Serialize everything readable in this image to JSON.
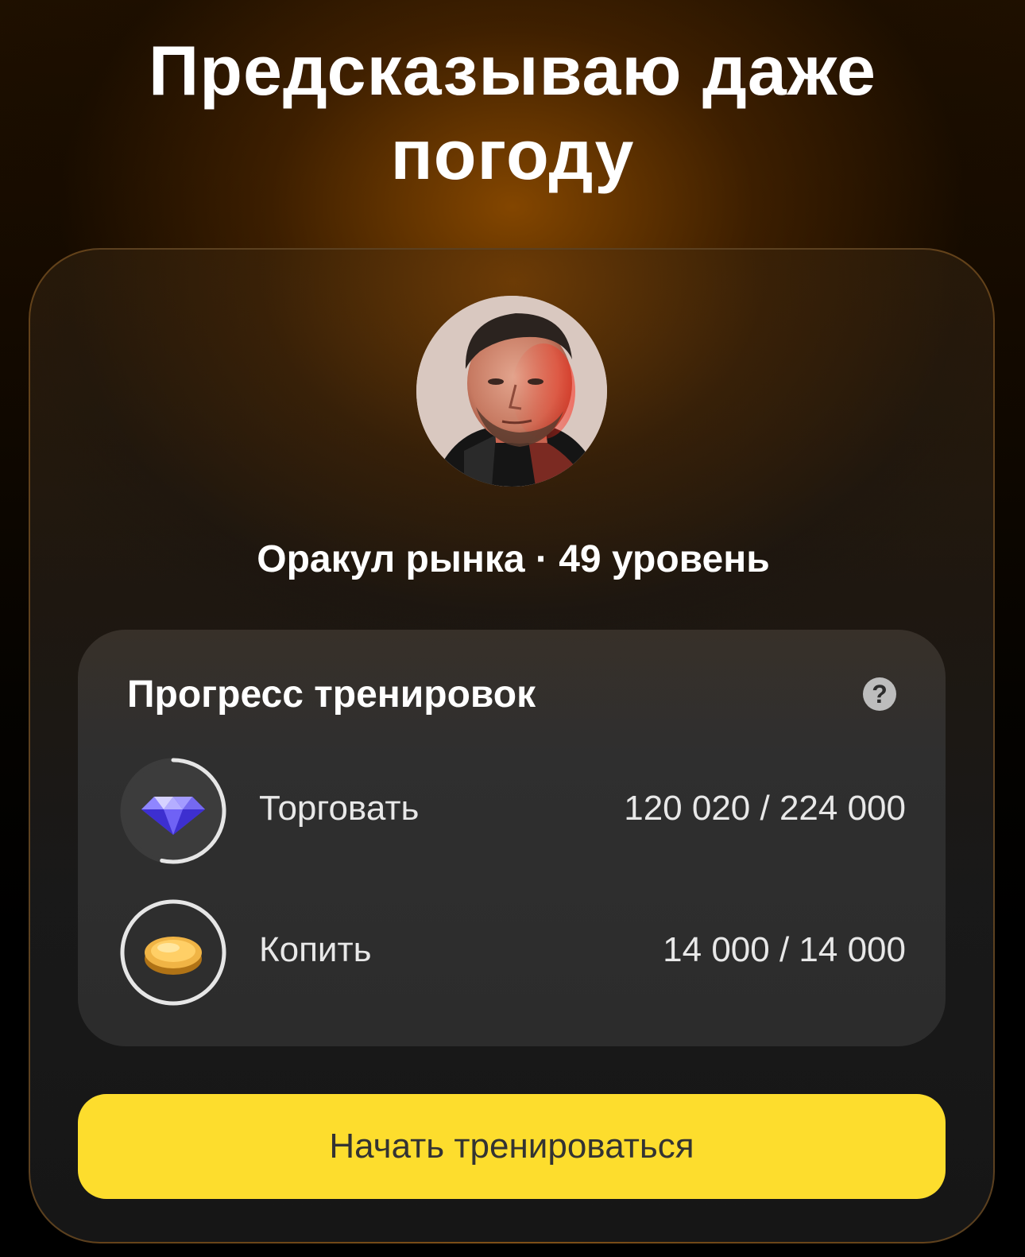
{
  "headline": {
    "line1": "Предсказываю даже",
    "line2": "погоду"
  },
  "profile": {
    "avatar_icon": "user-avatar-photo",
    "status_line": "Оракул рынка · 49 уровень"
  },
  "progress_panel": {
    "title": "Прогресс тренировок",
    "help_icon": "question-circle-icon",
    "help_glyph": "?",
    "items": [
      {
        "icon": "diamond-icon",
        "label": "Торговать",
        "value_text": "120 020 / 224 000",
        "current": 120020,
        "target": 224000,
        "ring_color": "#e6e6e6"
      },
      {
        "icon": "gold-coin-icon",
        "label": "Копить",
        "value_text": "14 000 / 14 000",
        "current": 14000,
        "target": 14000,
        "ring_color": "#e6e6e6"
      }
    ]
  },
  "cta": {
    "label": "Начать тренироваться",
    "color": "#fddd2d"
  }
}
